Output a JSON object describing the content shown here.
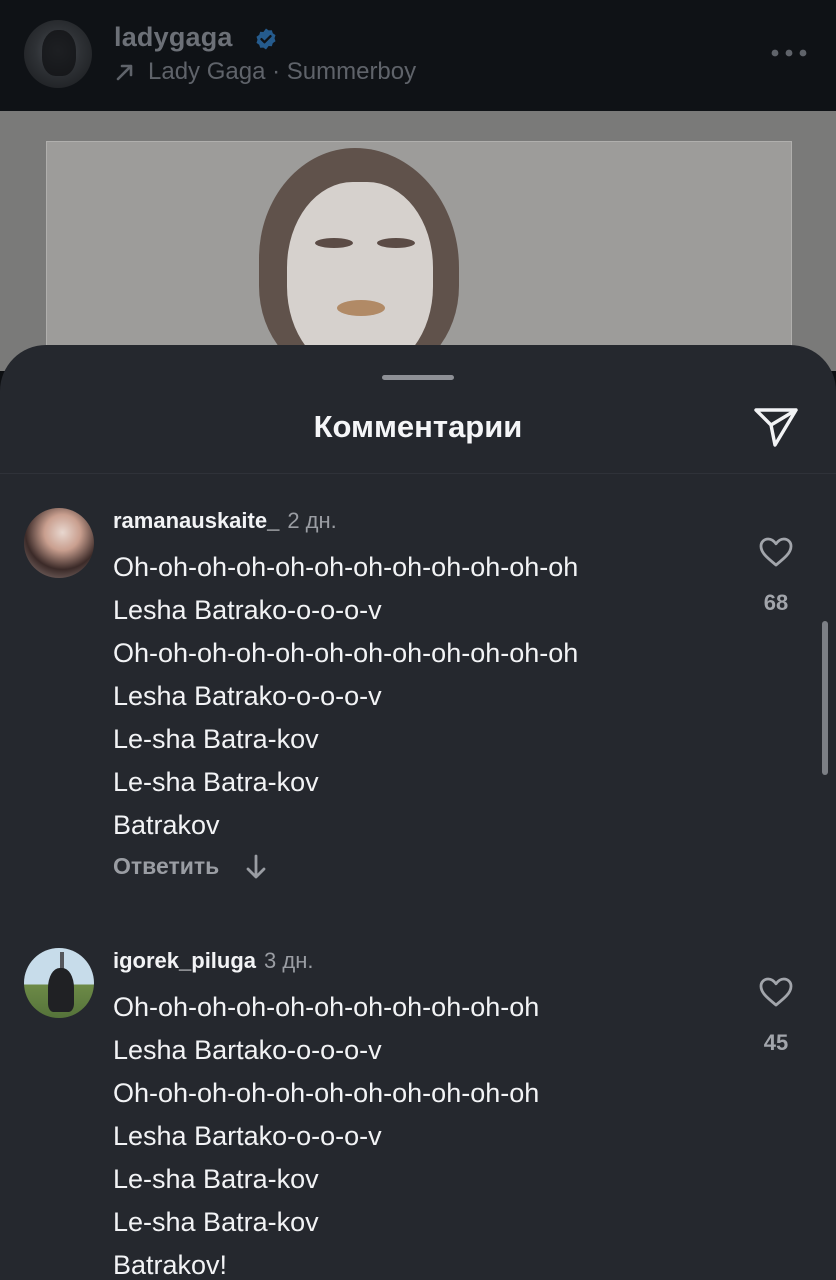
{
  "header": {
    "username": "ladygaga",
    "audio": "Lady Gaga · Summerboy"
  },
  "sheet": {
    "title": "Комментарии"
  },
  "comments": [
    {
      "username": "ramanauskaite_",
      "time": "2 дн.",
      "lines": [
        "Oh-oh-oh-oh-oh-oh-oh-oh-oh-oh-oh-oh",
        "Lesha Batrako-o-o-o-v",
        "Oh-oh-oh-oh-oh-oh-oh-oh-oh-oh-oh-oh",
        "Lesha Batrako-o-o-o-v",
        "Le-sha Batra-kov",
        "Le-sha Batra-kov",
        "Batrakov"
      ],
      "likes": "68",
      "reply_label": "Ответить"
    },
    {
      "username": "igorek_piluga",
      "time": "3 дн.",
      "lines": [
        "Oh-oh-oh-oh-oh-oh-oh-oh-oh-oh-oh",
        "Lesha Bartako-o-o-o-v",
        "Oh-oh-oh-oh-oh-oh-oh-oh-oh-oh-oh",
        "Lesha Bartako-o-o-o-v",
        "Le-sha Batra-kov",
        "Le-sha Batra-kov",
        "Batrakov!"
      ],
      "likes": "45"
    }
  ],
  "icons": {
    "verified": "verified-badge-icon",
    "audio": "arrow-up-right-icon",
    "more": "more-icon",
    "send": "send-icon",
    "like": "heart-icon",
    "expand_replies": "down-arrow-icon"
  },
  "colors": {
    "sheet_background": "#25282e",
    "verified_badge": "#3897f0",
    "secondary_text": "#9a9da3"
  }
}
